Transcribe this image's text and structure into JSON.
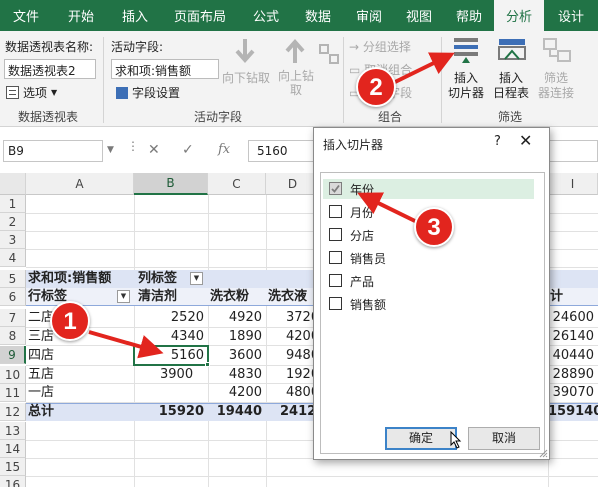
{
  "tabs": [
    {
      "label": "文件",
      "active": false
    },
    {
      "label": "开始",
      "active": false
    },
    {
      "label": "插入",
      "active": false
    },
    {
      "label": "页面布局",
      "active": false
    },
    {
      "label": "公式",
      "active": false
    },
    {
      "label": "数据",
      "active": false
    },
    {
      "label": "审阅",
      "active": false
    },
    {
      "label": "视图",
      "active": false
    },
    {
      "label": "帮助",
      "active": false
    },
    {
      "label": "分析",
      "active": true
    },
    {
      "label": "设计",
      "active": false
    }
  ],
  "ribbon": {
    "pivot_name_label": "数据透视表名称:",
    "pivot_name_value": "数据透视表2",
    "options_label": "选项",
    "group_pivot": "数据透视表",
    "active_field_label": "活动字段:",
    "active_field_value": "求和项:销售额",
    "field_settings_label": "字段设置",
    "drill_down_label": "向下钻取",
    "drill_up_label": "向上钻",
    "drill_up_label2": "取",
    "group_active_field": "活动字段",
    "group_selection_label": "→ 分组选择",
    "ungroup_label": "取消组合",
    "group_field_label": "分组字段",
    "group_group": "组合",
    "insert_slicer_line1": "插入",
    "insert_slicer_line2": "切片器",
    "insert_timeline_line1": "插入",
    "insert_timeline_line2": "日程表",
    "filter_connections_line1": "筛选",
    "filter_connections_line2": "器连接",
    "group_filter": "筛选"
  },
  "formula_bar": {
    "name_box": "B9",
    "fx": "fx",
    "value": "5160"
  },
  "columns": [
    "A",
    "B",
    "C",
    "D",
    "I"
  ],
  "rows": [
    "1",
    "2",
    "3",
    "4",
    "5",
    "6",
    "7",
    "8",
    "9",
    "10",
    "11",
    "12",
    "13",
    "14",
    "15",
    "16"
  ],
  "pivot": {
    "r5_a": "求和项:销售额",
    "r5_b": "列标签",
    "r6_a": "行标签",
    "r6_b": "清洁剂",
    "r6_c": "洗衣粉",
    "r6_d": "洗衣液",
    "r6_i": "计",
    "rows": [
      {
        "a": "二店",
        "b": "2520",
        "c": "4920",
        "d": "3720",
        "i": "24600"
      },
      {
        "a": "三店",
        "b": "4340",
        "c": "1890",
        "d": "4200",
        "i": "26140"
      },
      {
        "a": "四店",
        "b": "5160",
        "c": "3600",
        "d": "9480",
        "i": "40440"
      },
      {
        "a": "五店",
        "b": "3900",
        "c": "4830",
        "d": "1920",
        "i": "28890"
      },
      {
        "a": "一店",
        "b": "",
        "c": "4200",
        "d": "4800",
        "i": "39070"
      }
    ],
    "total": {
      "a": "总计",
      "b": "15920",
      "c": "19440",
      "d": "24120",
      "i": "159140"
    }
  },
  "dialog": {
    "title": "插入切片器",
    "help": "?",
    "close": "✕",
    "items": [
      {
        "label": "年份",
        "checked": true
      },
      {
        "label": "月份",
        "checked": false
      },
      {
        "label": "分店",
        "checked": false
      },
      {
        "label": "销售员",
        "checked": false
      },
      {
        "label": "产品",
        "checked": false
      },
      {
        "label": "销售额",
        "checked": false
      }
    ],
    "ok": "确定",
    "cancel": "取消"
  },
  "callouts": [
    "1",
    "2",
    "3"
  ],
  "accent": "#217346",
  "callout_color": "#e2251e"
}
